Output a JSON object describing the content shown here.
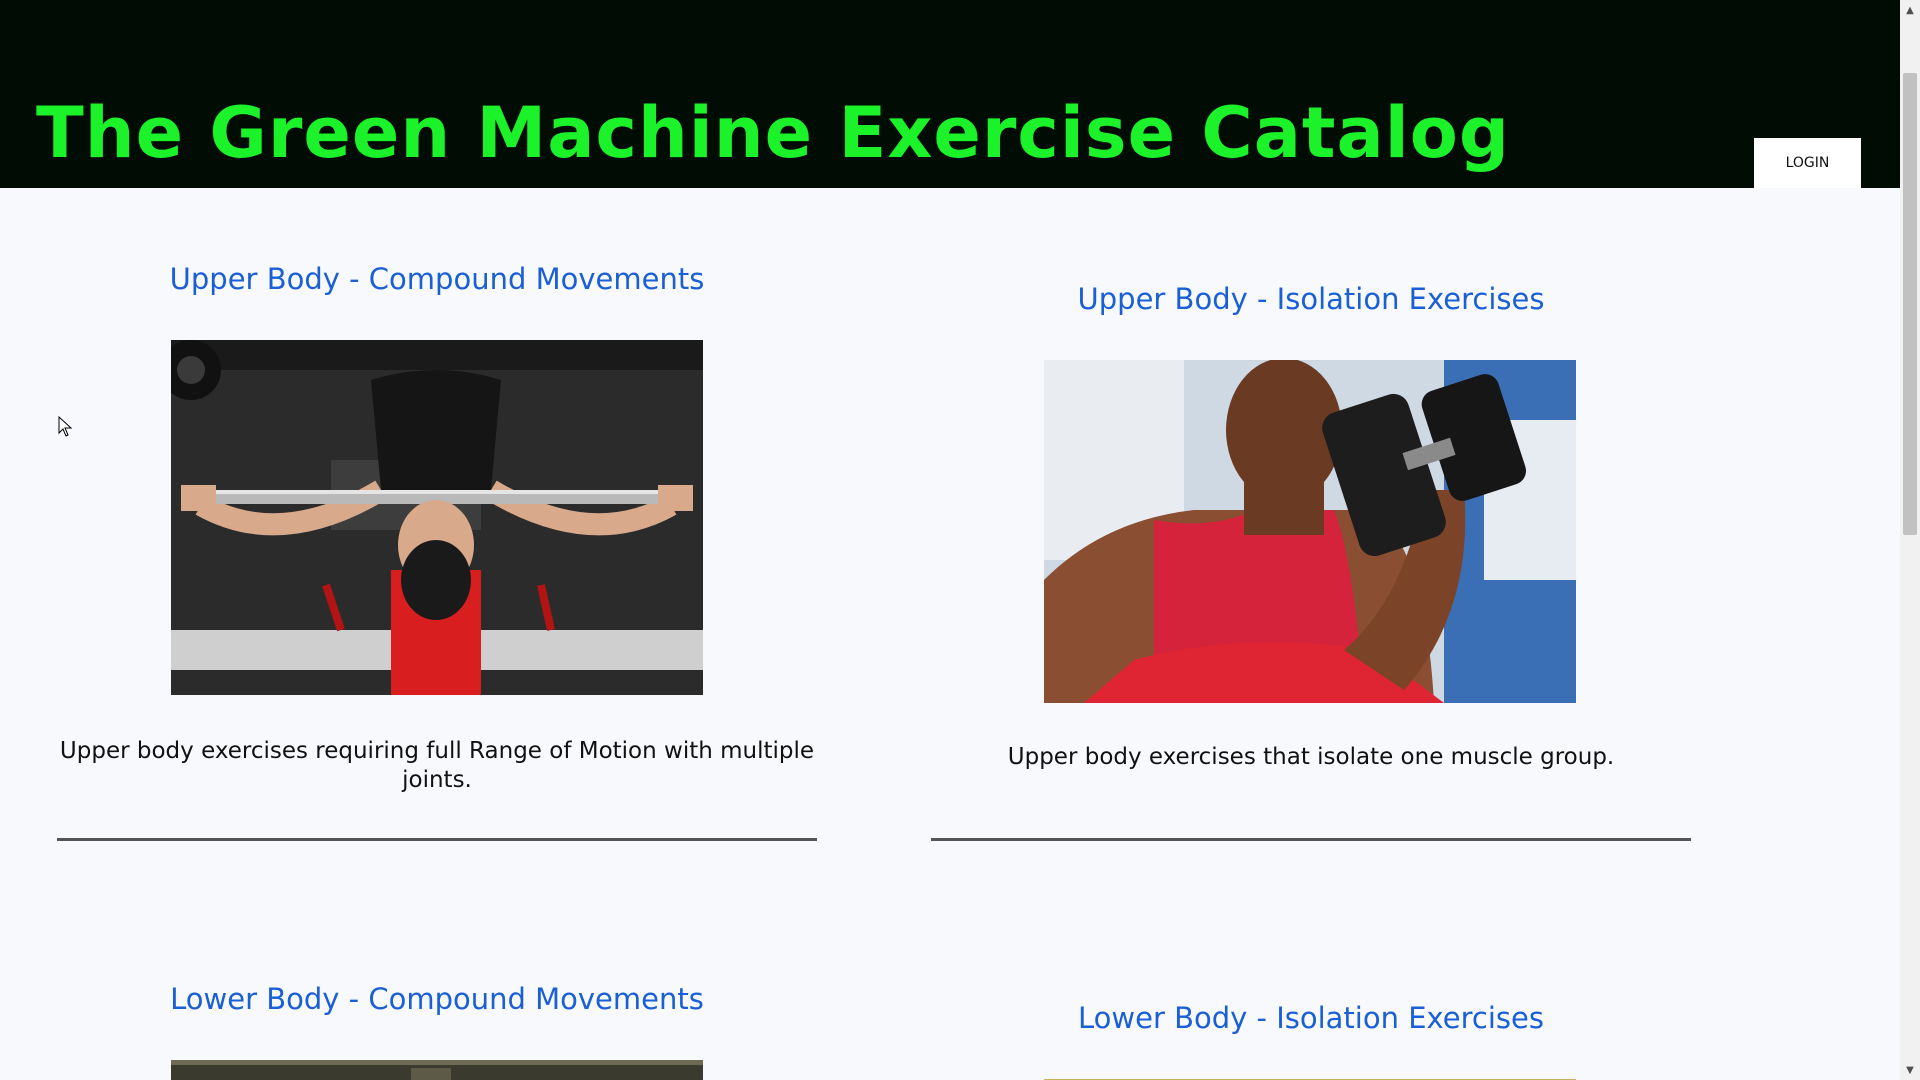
{
  "header": {
    "title": "The Green Machine Exercise Catalog",
    "login_label": "LOGIN",
    "title_color": "#1bf229",
    "background_color": "#010d04"
  },
  "categories": [
    {
      "title": "Upper Body - Compound Movements",
      "description": "Upper body exercises requiring full Range of Motion with multiple joints.",
      "image": "bench-press-photo"
    },
    {
      "title": "Upper Body - Isolation Exercises",
      "description": "Upper body exercises that isolate one muscle group.",
      "image": "dumbbell-curl-photo"
    },
    {
      "title": "Lower Body - Compound Movements",
      "description": "",
      "image": "lower-body-compound-photo"
    },
    {
      "title": "Lower Body - Isolation Exercises",
      "description": "",
      "image": "lower-body-isolation-photo"
    }
  ],
  "colors": {
    "link": "#1a5fd6",
    "page_background": "#f7f9fc"
  }
}
